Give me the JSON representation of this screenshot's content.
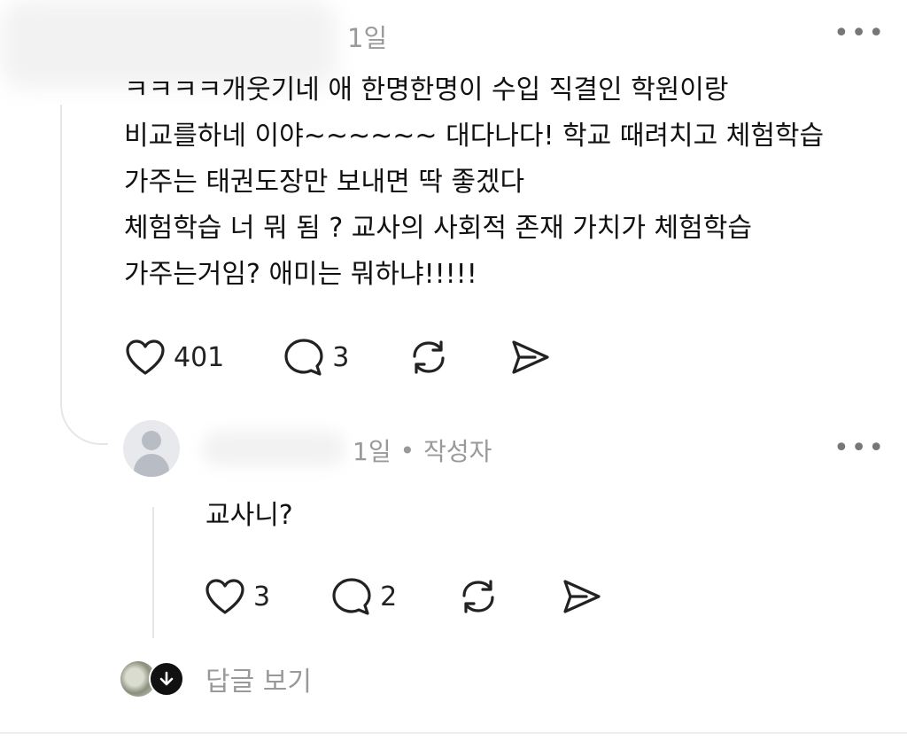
{
  "post": {
    "time": "1일",
    "more": "•••",
    "lines": [
      "ㅋㅋㅋㅋ개웃기네 애 한명한명이 수입 직결인 학원이랑",
      "비교를하네 이야~~~~~~ 대다나다! 학교 때려치고 체험학습",
      "가주는 태권도장만 보내면 딱 좋겠다",
      "체험학습 너 뭐 됨 ? 교사의 사회적 존재 가치가 체험학습",
      "가주는거임? 애미는 뭐하냐!!!!!"
    ],
    "likes": "401",
    "comments": "3"
  },
  "reply": {
    "time": "1일",
    "separator": "•",
    "author_tag": "작성자",
    "more": "•••",
    "text": "교사니?",
    "likes": "3",
    "comments": "2"
  },
  "view_replies": {
    "label": "답글 보기"
  },
  "icons": {
    "like": "heart-icon",
    "comment": "comment-bubble-icon",
    "repost": "repost-icon",
    "share": "send-icon",
    "more": "more-dots-icon",
    "expand": "arrow-down-icon"
  },
  "colors": {
    "text": "#111111",
    "muted": "#999999",
    "line": "#e6e6e6"
  }
}
